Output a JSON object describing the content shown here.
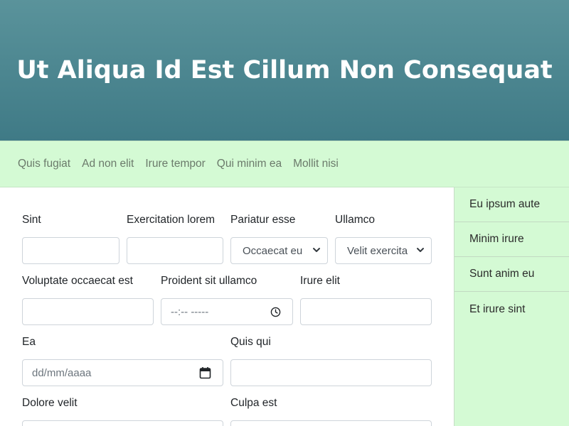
{
  "header": {
    "title": "Ut Aliqua Id Est Cillum Non Consequat"
  },
  "nav": {
    "links": [
      "Quis fugiat",
      "Ad non elit",
      "Irure tempor",
      "Qui minim ea",
      "Mollit nisi"
    ]
  },
  "form": {
    "row1": {
      "f1": {
        "label": "Sint",
        "value": ""
      },
      "f2": {
        "label": "Exercitation lorem",
        "value": ""
      },
      "f3": {
        "label": "Pariatur esse",
        "selected": "Occaecat eu"
      },
      "f4": {
        "label": "Ullamco",
        "selected": "Velit exercita"
      }
    },
    "row2": {
      "f1": {
        "label": "Voluptate occaecat est",
        "value": ""
      },
      "f2": {
        "label": "Proident sit ullamco",
        "placeholder": "--:-- -----"
      },
      "f3": {
        "label": "Irure elit",
        "value": ""
      }
    },
    "row3": {
      "f1": {
        "label": "Ea",
        "placeholder": "dd/mm/aaaa"
      },
      "f2": {
        "label": "Quis qui",
        "value": ""
      }
    },
    "row4": {
      "f1": {
        "label": "Dolore velit",
        "value": ""
      },
      "f2": {
        "label": "Culpa est",
        "value": ""
      }
    }
  },
  "sidebar": {
    "items": [
      "Eu ipsum aute",
      "Minim irure",
      "Sunt anim eu",
      "Et irure sint"
    ]
  },
  "icons": {
    "select_chevron": "chevron-down-icon",
    "time": "clock-icon",
    "date": "calendar-icon"
  },
  "colors": {
    "hero_top": "#5a939b",
    "hero_bottom": "#3f7a86",
    "nav_bg": "#d4fad4",
    "sidebar_bg": "#d4fad4"
  }
}
